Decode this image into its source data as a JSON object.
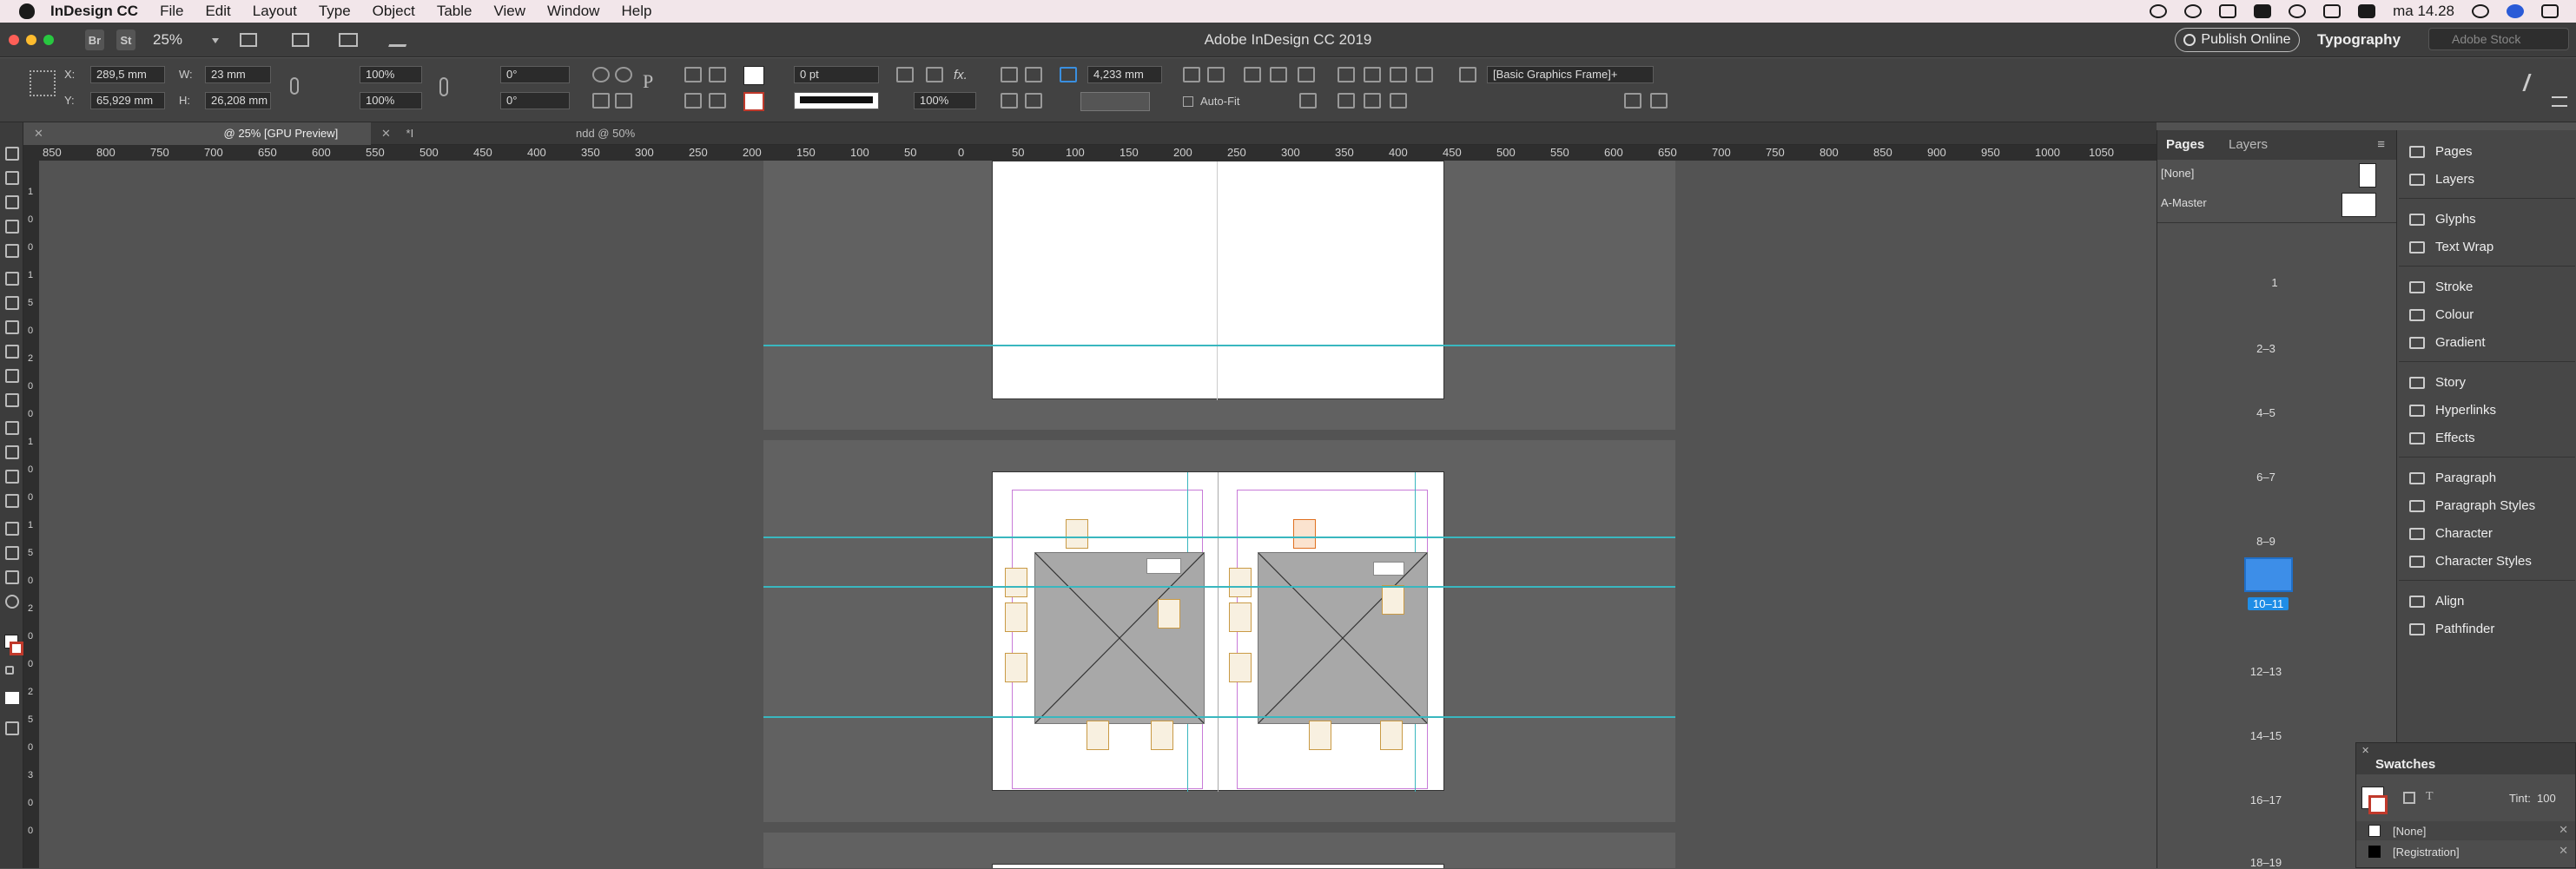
{
  "menubar": {
    "app": "InDesign CC",
    "menus": [
      "File",
      "Edit",
      "Layout",
      "Type",
      "Object",
      "Table",
      "View",
      "Window",
      "Help"
    ],
    "clock": "ma 14.28"
  },
  "appbar": {
    "bridge": "Br",
    "stock": "St",
    "zoom": "25%",
    "title": "Adobe InDesign CC 2019",
    "publish": "Publish Online",
    "workspace": "Typography",
    "search_placeholder": "Adobe Stock"
  },
  "control": {
    "x_label": "X:",
    "x_val": "289,5 mm",
    "y_label": "Y:",
    "y_val": "65,929 mm",
    "w_label": "W:",
    "w_val": "23 mm",
    "h_label": "H:",
    "h_val": "26,208 mm",
    "scale_x": "100%",
    "scale_y": "100%",
    "rot": "0°",
    "shear": "0°",
    "stroke_weight": "0 pt",
    "opacity": "100%",
    "gap": "4,233 mm",
    "autofit": "Auto-Fit",
    "style": "[Basic Graphics Frame]+"
  },
  "doctabs": {
    "tab1": "@ 25% [GPU Preview]",
    "tab2": "*I",
    "tab3": "ndd @ 50%"
  },
  "ruler": {
    "h_ticks": [
      "850",
      "800",
      "750",
      "700",
      "650",
      "600",
      "550",
      "500",
      "450",
      "400",
      "350",
      "300",
      "250",
      "200",
      "150",
      "100",
      "50",
      "0",
      "50",
      "100",
      "150",
      "200",
      "250",
      "300",
      "350",
      "400",
      "450",
      "500",
      "550",
      "600",
      "650",
      "700",
      "750",
      "800",
      "850",
      "900",
      "950",
      "1000",
      "1050"
    ],
    "v_ticks": [
      "1",
      "0",
      "0",
      "1",
      "5",
      "0",
      "2",
      "0",
      "0",
      "1",
      "0",
      "0",
      "1",
      "5",
      "0",
      "2",
      "0",
      "0",
      "2",
      "5",
      "0",
      "3",
      "0",
      "0"
    ]
  },
  "pages_panel": {
    "tab_pages": "Pages",
    "tab_layers": "Layers",
    "none": "[None]",
    "master": "A-Master",
    "spreads": [
      "1",
      "2–3",
      "4–5",
      "6–7",
      "8–9",
      "10–11",
      "12–13",
      "14–15",
      "16–17",
      "18–19"
    ],
    "selected": "10–11"
  },
  "right_panel": {
    "items": [
      "Pages",
      "Layers",
      "Glyphs",
      "Text Wrap",
      "Stroke",
      "Colour",
      "Gradient",
      "Story",
      "Hyperlinks",
      "Effects",
      "Paragraph",
      "Paragraph Styles",
      "Character",
      "Character Styles",
      "Align",
      "Pathfinder"
    ]
  },
  "swatches": {
    "title": "Swatches",
    "tint_label": "Tint:",
    "tint_val": "100",
    "rows": [
      "[None]",
      "[Registration]"
    ]
  }
}
